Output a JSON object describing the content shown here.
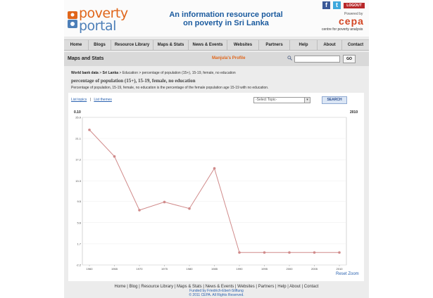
{
  "header": {
    "logo_top": "poverty",
    "logo_bottom": "portal",
    "tagline_1": "An information resource portal",
    "tagline_2": "on poverty in Sri Lanka",
    "logout_label": "LOGOUT",
    "powered_by": "Powered by",
    "cepa_logo": "cepa",
    "cepa_sub": "centre for poverty analysis"
  },
  "nav": [
    "Home",
    "Blogs",
    "Resource Library",
    "Maps & Stats",
    "News & Events",
    "Websites",
    "Partners",
    "Help",
    "About",
    "Contact"
  ],
  "titlebar": {
    "section_title": "Maps and Stats",
    "profile_link": "Manjula's Profile",
    "go_label": "GO",
    "search_value": ""
  },
  "breadcrumb": {
    "source": "World bank data",
    "country": "Sri Lanka",
    "rest": " > Education > percentage of population (15+), 15-19, female, no education"
  },
  "indicator": {
    "title": "percentage of population (15+), 15-19, female, no education",
    "description": "Percentage of population, 15-19, female, no education is the percentage of the female population age 15-19 with no education."
  },
  "controls": {
    "list_topics": "List topics",
    "separator": "|",
    "list_themes": "List themes",
    "select_value": "-Select Topic-",
    "search_label": "SEARCH"
  },
  "chart_data": {
    "type": "line",
    "top_left_label": "0.10",
    "top_right_label": "2010",
    "x": [
      1960,
      1965,
      1970,
      1975,
      1980,
      1985,
      1990,
      1995,
      2000,
      2005,
      2010
    ],
    "series": [
      {
        "values": [
          22.7,
          17.8,
          7.9,
          9.4,
          8.2,
          15.6,
          0.1,
          0.1,
          0.1,
          0.1,
          0.1
        ]
      }
    ],
    "y_ticks": [
      "25.0",
      "21.1",
      "17.2",
      "13.3",
      "9.5",
      "5.6",
      "1.7",
      "-2.2"
    ],
    "ylim": [
      -2.2,
      25.0
    ],
    "line_color": "#d08a8a",
    "reset_zoom": "Reset Zoom"
  },
  "footer": {
    "links": [
      "Home",
      "Blog",
      "Resource Library",
      "Maps & Stats",
      "News & Events",
      "Websites",
      "Partners",
      "Help",
      "About",
      "Contact"
    ],
    "funded": "Funded by Friedrich-Ebert-Stiftung",
    "copyright": "© 2011 CEPA. All Rights Reserved."
  }
}
